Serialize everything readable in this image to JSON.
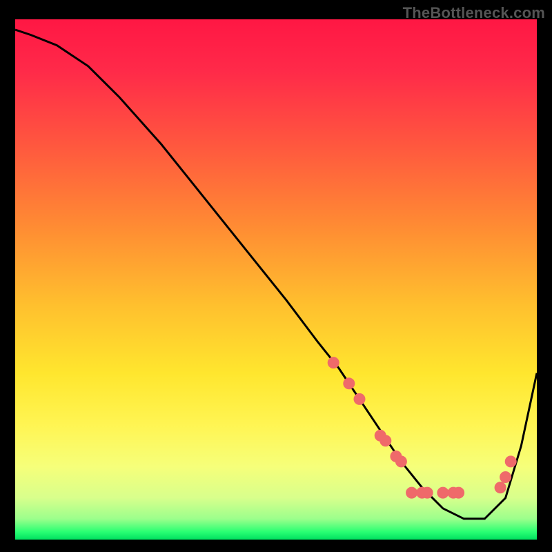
{
  "watermark": "TheBottleneck.com",
  "colors": {
    "background": "#000000",
    "gradient_stops": [
      {
        "offset": 0.0,
        "color": "#ff1744"
      },
      {
        "offset": 0.1,
        "color": "#ff2a49"
      },
      {
        "offset": 0.25,
        "color": "#ff5a3e"
      },
      {
        "offset": 0.4,
        "color": "#ff8c33"
      },
      {
        "offset": 0.55,
        "color": "#ffc02e"
      },
      {
        "offset": 0.68,
        "color": "#ffe62e"
      },
      {
        "offset": 0.78,
        "color": "#fff553"
      },
      {
        "offset": 0.86,
        "color": "#f6ff7a"
      },
      {
        "offset": 0.92,
        "color": "#d8ff8c"
      },
      {
        "offset": 0.96,
        "color": "#9cff8c"
      },
      {
        "offset": 0.985,
        "color": "#2aff73"
      },
      {
        "offset": 1.0,
        "color": "#00e060"
      }
    ],
    "curve": "#000000",
    "marker_fill": "#ef6a6a",
    "marker_stroke": "#ef6a6a"
  },
  "chart_data": {
    "type": "line",
    "title": "",
    "xlabel": "",
    "ylabel": "",
    "xlim": [
      0,
      100
    ],
    "ylim": [
      0,
      100
    ],
    "series": [
      {
        "name": "bottleneck-curve",
        "x": [
          0,
          3,
          8,
          14,
          20,
          28,
          36,
          44,
          52,
          58,
          62,
          66,
          70,
          74,
          78,
          82,
          86,
          90,
          94,
          97,
          100
        ],
        "y": [
          98,
          97,
          95,
          91,
          85,
          76,
          66,
          56,
          46,
          38,
          33,
          27,
          21,
          15,
          10,
          6,
          4,
          4,
          8,
          18,
          32
        ]
      }
    ],
    "markers": {
      "name": "highlight-points",
      "x": [
        61,
        64,
        66,
        70,
        71,
        73,
        74,
        76,
        78,
        79,
        82,
        84,
        85,
        93,
        94,
        95
      ],
      "y": [
        34,
        30,
        27,
        20,
        19,
        16,
        15,
        9,
        9,
        9,
        9,
        9,
        9,
        10,
        12,
        15
      ]
    }
  }
}
